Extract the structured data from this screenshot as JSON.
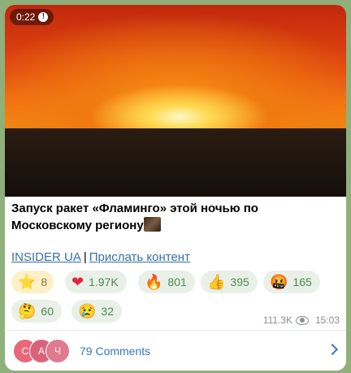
{
  "video": {
    "duration": "0:22",
    "mute_icon": "!"
  },
  "caption": {
    "text": "Запуск ракет «Фламинго» этой ночью по Московскому региону"
  },
  "links": {
    "channel": "INSIDER UA",
    "separator": "|",
    "submit": "Прислать контент"
  },
  "reactions": [
    {
      "emoji": "⭐",
      "count": "8",
      "icon": "star-icon"
    },
    {
      "emoji": "❤",
      "count": "1.97K",
      "icon": "heart-icon"
    },
    {
      "emoji": "🔥",
      "count": "801",
      "icon": "fire-icon"
    },
    {
      "emoji": "👍",
      "count": "395",
      "icon": "thumbs-up-icon"
    },
    {
      "emoji": "🤬",
      "count": "165",
      "icon": "angry-face-icon"
    },
    {
      "emoji": "🤔",
      "count": "60",
      "icon": "thinking-face-icon"
    },
    {
      "emoji": "😢",
      "count": "32",
      "icon": "crying-face-icon"
    }
  ],
  "meta": {
    "views": "111.3K",
    "time": "15:03"
  },
  "comments": {
    "label": "79 Comments",
    "avatars": [
      {
        "letter": "С",
        "color": "#e8677a"
      },
      {
        "letter": "А",
        "color": "#d9637a"
      },
      {
        "letter": "Ч",
        "color": "#e07a8e"
      }
    ]
  },
  "colors": {
    "link": "#3a6fa6",
    "reaction_bg": "#e8f0e8",
    "reaction_text": "#4e8a55",
    "background": "#8fb07a"
  }
}
